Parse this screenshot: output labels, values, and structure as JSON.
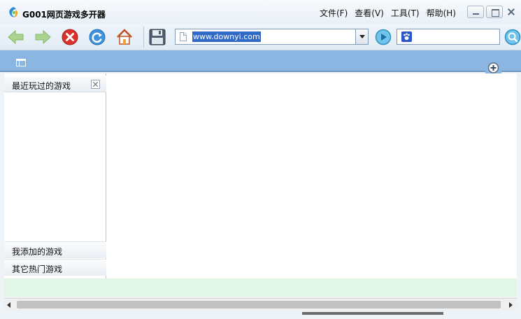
{
  "window": {
    "title": "G001网页游戏多开器"
  },
  "menu": {
    "items": [
      {
        "label": "文件(F)"
      },
      {
        "label": "查看(V)"
      },
      {
        "label": "工具(T)"
      },
      {
        "label": "帮助(H)"
      }
    ]
  },
  "toolbar": {
    "icons": [
      "back-arrow-icon",
      "forward-arrow-icon",
      "stop-icon",
      "refresh-icon",
      "home-icon",
      "save-icon"
    ],
    "address_value": "www.downyi.com",
    "go_icon": "go-arrow-icon",
    "search_value": "",
    "search_engine_icon": "paw-icon",
    "search_icon": "magnifier-icon"
  },
  "sidebar": {
    "recent_header": "最近玩过的游戏",
    "added_section": "我添加的游戏",
    "hot_section": "其它热门游戏"
  },
  "colors": {
    "tabstrip": "#8cb6e2",
    "status_area": "#e2f6e8",
    "url_selection": "#3169c6"
  }
}
